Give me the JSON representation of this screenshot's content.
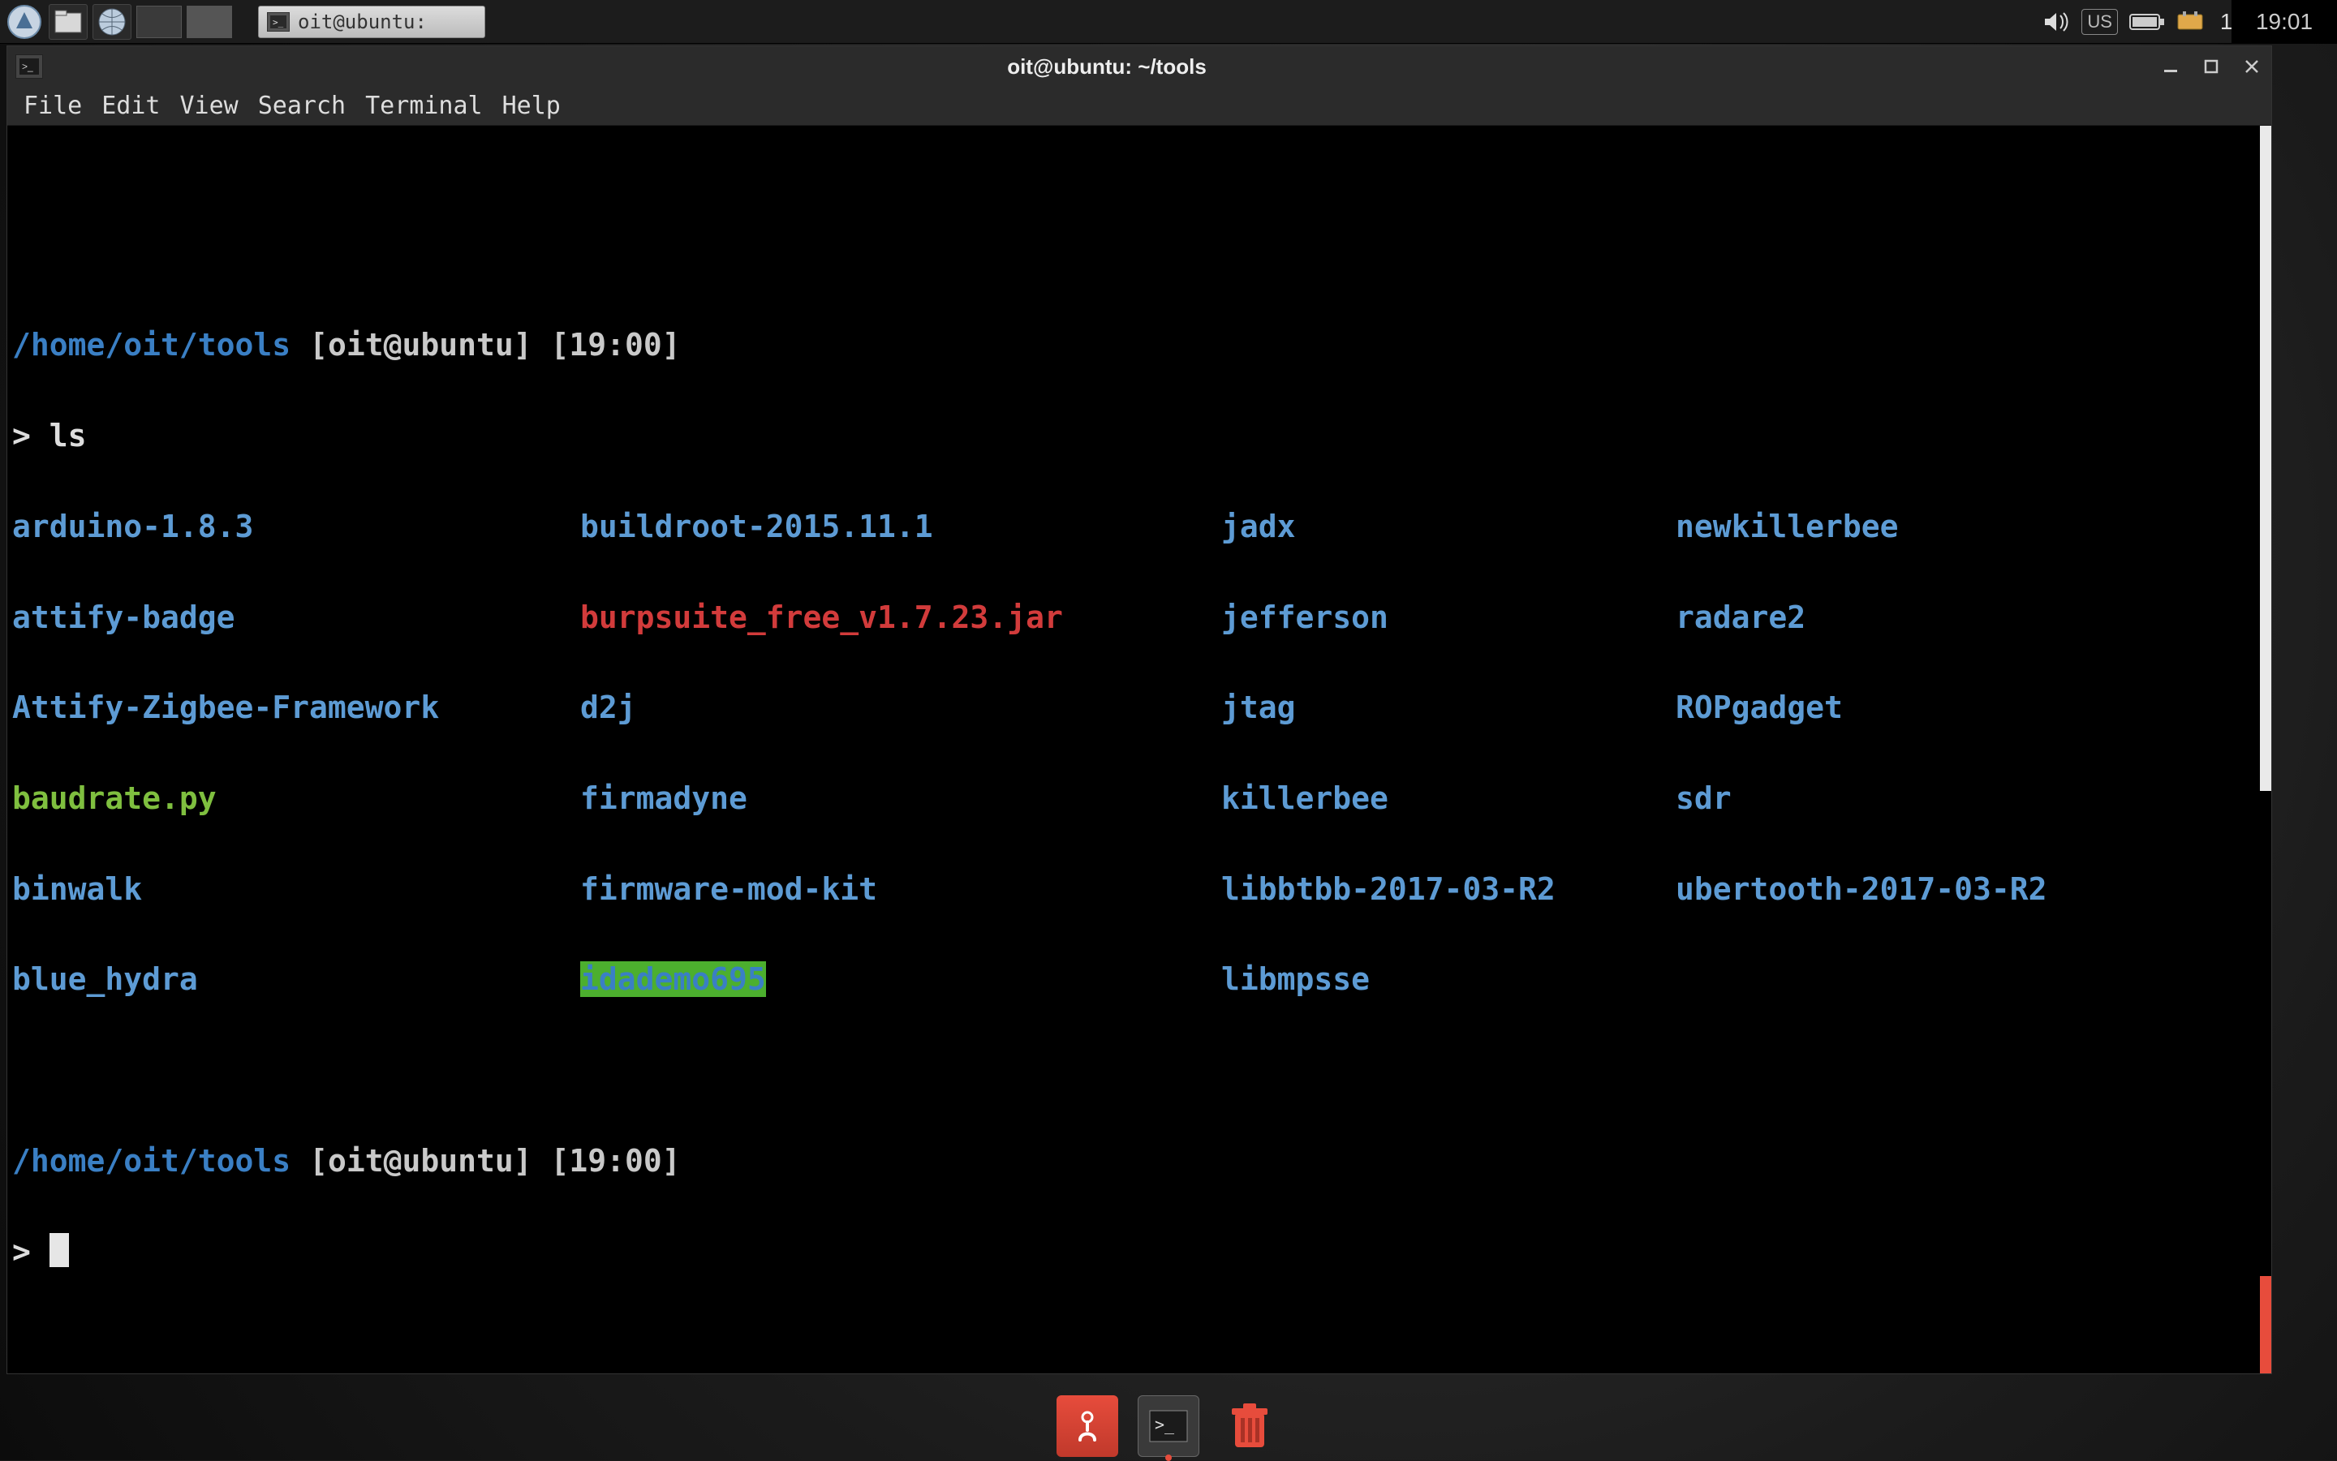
{
  "panel": {
    "clock": "19:01",
    "extra_clock": "19:01",
    "task_label": "oit@ubuntu:",
    "icons": {
      "start": "start-menu-icon",
      "files": "file-manager-icon",
      "web": "browser-icon",
      "ws1": "workspace-1",
      "ws2": "workspace-2",
      "volume": "volume-icon",
      "kbd": "keyboard-layout-icon",
      "battery": "battery-icon",
      "net": "network-icon",
      "power": "power-icon"
    }
  },
  "window": {
    "title": "oit@ubuntu: ~/tools",
    "menu": {
      "file": "File",
      "edit": "Edit",
      "view": "View",
      "search": "Search",
      "terminal": "Terminal",
      "help": "Help"
    }
  },
  "prompt1": {
    "path": "/home/oit/tools",
    "host": "[oit@ubuntu]",
    "time": "[19:00]",
    "cmd_marker": ">",
    "command": "ls"
  },
  "ls": {
    "col1": [
      {
        "t": "arduino-1.8.3",
        "c": "dir"
      },
      {
        "t": "attify-badge",
        "c": "dir"
      },
      {
        "t": "Attify-Zigbee-Framework",
        "c": "dir"
      },
      {
        "t": "baudrate.py",
        "c": "exec"
      },
      {
        "t": "binwalk",
        "c": "dir"
      },
      {
        "t": "blue_hydra",
        "c": "dir"
      }
    ],
    "col2": [
      {
        "t": "buildroot-2015.11.1",
        "c": "dir"
      },
      {
        "t": "burpsuite_free_v1.7.23.jar",
        "c": "jar"
      },
      {
        "t": "d2j",
        "c": "dir"
      },
      {
        "t": "firmadyne",
        "c": "dir"
      },
      {
        "t": "firmware-mod-kit",
        "c": "dir"
      },
      {
        "t": "idademo695",
        "c": "sel"
      }
    ],
    "col3": [
      {
        "t": "jadx",
        "c": "dir"
      },
      {
        "t": "jefferson",
        "c": "dir"
      },
      {
        "t": "jtag",
        "c": "dir"
      },
      {
        "t": "killerbee",
        "c": "dir"
      },
      {
        "t": "libbtbb-2017-03-R2",
        "c": "dir"
      },
      {
        "t": "libmpsse",
        "c": "dir"
      }
    ],
    "col4": [
      {
        "t": "newkillerbee",
        "c": "dir"
      },
      {
        "t": "radare2",
        "c": "dir"
      },
      {
        "t": "ROPgadget",
        "c": "dir"
      },
      {
        "t": "sdr",
        "c": "dir"
      },
      {
        "t": "ubertooth-2017-03-R2",
        "c": "dir"
      }
    ]
  },
  "prompt2": {
    "path": "/home/oit/tools",
    "host": "[oit@ubuntu]",
    "time": "[19:00]",
    "cmd_marker": ">"
  },
  "dock": {
    "anchor": "anchor-app",
    "terminal": "terminal-app",
    "trash": "trash"
  }
}
